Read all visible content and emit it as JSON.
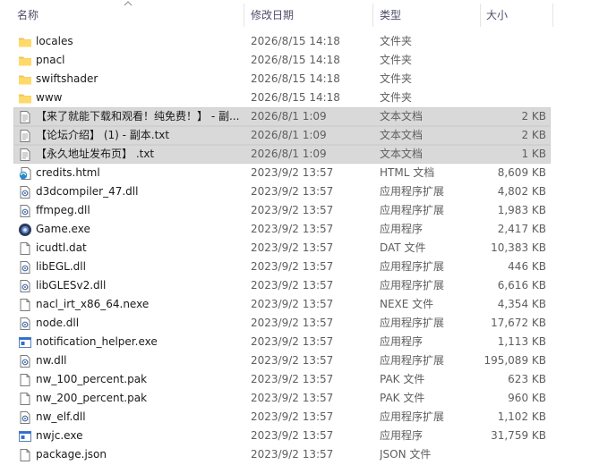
{
  "columns": {
    "name": "名称",
    "date": "修改日期",
    "type": "类型",
    "size": "大小"
  },
  "files": [
    {
      "name": "locales",
      "date": "2026/8/15 14:18",
      "type": "文件夹",
      "size": "",
      "icon": "folder-icon",
      "selected": false
    },
    {
      "name": "pnacl",
      "date": "2026/8/15 14:18",
      "type": "文件夹",
      "size": "",
      "icon": "folder-icon",
      "selected": false
    },
    {
      "name": "swiftshader",
      "date": "2026/8/15 14:18",
      "type": "文件夹",
      "size": "",
      "icon": "folder-icon",
      "selected": false
    },
    {
      "name": "www",
      "date": "2026/8/15 14:18",
      "type": "文件夹",
      "size": "",
      "icon": "folder-icon",
      "selected": false
    },
    {
      "name": "【来了就能下载和观看！纯免费！】 - 副...",
      "date": "2026/8/1 1:09",
      "type": "文本文档",
      "size": "2 KB",
      "icon": "text-file-icon",
      "selected": true
    },
    {
      "name": "【论坛介绍】 (1) - 副本.txt",
      "date": "2026/8/1 1:09",
      "type": "文本文档",
      "size": "2 KB",
      "icon": "text-file-icon",
      "selected": true
    },
    {
      "name": "【永久地址发布页】 .txt",
      "date": "2026/8/1 1:09",
      "type": "文本文档",
      "size": "1 KB",
      "icon": "text-file-icon",
      "selected": true
    },
    {
      "name": "credits.html",
      "date": "2023/9/2 13:57",
      "type": "HTML 文档",
      "size": "8,609 KB",
      "icon": "html-file-icon",
      "selected": false
    },
    {
      "name": "d3dcompiler_47.dll",
      "date": "2023/9/2 13:57",
      "type": "应用程序扩展",
      "size": "4,802 KB",
      "icon": "dll-file-icon",
      "selected": false
    },
    {
      "name": "ffmpeg.dll",
      "date": "2023/9/2 13:57",
      "type": "应用程序扩展",
      "size": "1,983 KB",
      "icon": "dll-file-icon",
      "selected": false
    },
    {
      "name": "Game.exe",
      "date": "2023/9/2 13:57",
      "type": "应用程序",
      "size": "2,417 KB",
      "icon": "game-exe-icon",
      "selected": false
    },
    {
      "name": "icudtl.dat",
      "date": "2023/9/2 13:57",
      "type": "DAT 文件",
      "size": "10,383 KB",
      "icon": "blank-file-icon",
      "selected": false
    },
    {
      "name": "libEGL.dll",
      "date": "2023/9/2 13:57",
      "type": "应用程序扩展",
      "size": "446 KB",
      "icon": "dll-file-icon",
      "selected": false
    },
    {
      "name": "libGLESv2.dll",
      "date": "2023/9/2 13:57",
      "type": "应用程序扩展",
      "size": "6,616 KB",
      "icon": "dll-file-icon",
      "selected": false
    },
    {
      "name": "nacl_irt_x86_64.nexe",
      "date": "2023/9/2 13:57",
      "type": "NEXE 文件",
      "size": "4,354 KB",
      "icon": "blank-file-icon",
      "selected": false
    },
    {
      "name": "node.dll",
      "date": "2023/9/2 13:57",
      "type": "应用程序扩展",
      "size": "17,672 KB",
      "icon": "dll-file-icon",
      "selected": false
    },
    {
      "name": "notification_helper.exe",
      "date": "2023/9/2 13:57",
      "type": "应用程序",
      "size": "1,113 KB",
      "icon": "exe-file-icon",
      "selected": false
    },
    {
      "name": "nw.dll",
      "date": "2023/9/2 13:57",
      "type": "应用程序扩展",
      "size": "195,089 KB",
      "icon": "dll-file-icon",
      "selected": false
    },
    {
      "name": "nw_100_percent.pak",
      "date": "2023/9/2 13:57",
      "type": "PAK 文件",
      "size": "623 KB",
      "icon": "blank-file-icon",
      "selected": false
    },
    {
      "name": "nw_200_percent.pak",
      "date": "2023/9/2 13:57",
      "type": "PAK 文件",
      "size": "960 KB",
      "icon": "blank-file-icon",
      "selected": false
    },
    {
      "name": "nw_elf.dll",
      "date": "2023/9/2 13:57",
      "type": "应用程序扩展",
      "size": "1,102 KB",
      "icon": "dll-file-icon",
      "selected": false
    },
    {
      "name": "nwjc.exe",
      "date": "2023/9/2 13:57",
      "type": "应用程序",
      "size": "31,759 KB",
      "icon": "exe-file-icon",
      "selected": false
    },
    {
      "name": "package.json",
      "date": "2023/9/2 13:57",
      "type": "JSON 文件",
      "size": "",
      "icon": "blank-file-icon",
      "selected": false
    }
  ]
}
